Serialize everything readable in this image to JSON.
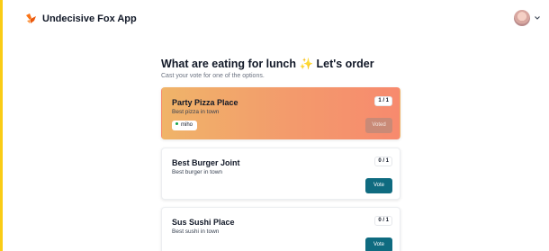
{
  "app": {
    "title": "Undecisive Fox App"
  },
  "poll": {
    "title": "What are eating for lunch ✨ Let's order",
    "subtitle": "Cast your vote for one of the options."
  },
  "options": [
    {
      "name": "Party Pizza Place",
      "description": "Best pizza in town",
      "count": "1 / 1",
      "button": "Voted",
      "selected": true,
      "voters": [
        "miho"
      ]
    },
    {
      "name": "Best Burger Joint",
      "description": "Best burger in town",
      "count": "0 / 1",
      "button": "Vote",
      "selected": false,
      "voters": []
    },
    {
      "name": "Sus Sushi Place",
      "description": "Best sushi in town",
      "count": "0 / 1",
      "button": "Vote",
      "selected": false,
      "voters": []
    }
  ],
  "colors": {
    "accent": "#facc15",
    "button": "#0f6b80",
    "brand": "#f97316",
    "selected_from": "#f0b469",
    "selected_to": "#f78a6e"
  },
  "icons": {
    "logo": "fox-logo-icon",
    "avatar": "user-avatar",
    "menu": "chevron-down-icon"
  }
}
